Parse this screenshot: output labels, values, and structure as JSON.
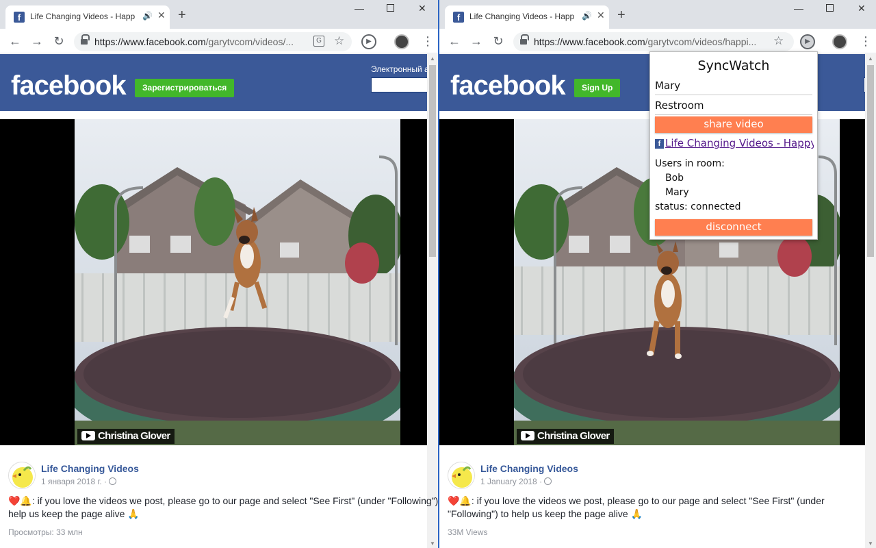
{
  "left_window": {
    "tab_title": "Life Changing Videos - Happ",
    "url_domain": "https://www.facebook.com",
    "url_path": "/garytvcom/videos/...",
    "fb_logo": "facebook",
    "signup_label": "Зарегистрироваться",
    "email_label": "Электронный а",
    "post": {
      "page_name": "Life Changing Videos",
      "date": "1 января 2018 г. ·",
      "text": "❤️🔔: if you love the videos we post, please go to our page and select \"See First\" (under \"Following\") to help us keep the page alive 🙏",
      "views": "Просмотры: 33 млн"
    },
    "video_credit": "Christina Glover"
  },
  "right_window": {
    "tab_title": "Life Changing Videos - Happ",
    "url_domain": "https://www.facebook.com",
    "url_path": "/garytvcom/videos/happi...",
    "fb_logo": "facebook",
    "signup_label": "Sign Up",
    "post": {
      "page_name": "Life Changing Videos",
      "date": "1 January 2018 ·",
      "text": "❤️🔔: if you love the videos we post, please go to our page and select \"See First\" (under \"Following\") to help us keep the page alive 🙏",
      "views": "33M Views"
    },
    "video_credit": "Christina Glover"
  },
  "syncwatch": {
    "title": "SyncWatch",
    "username": "Mary",
    "room": "Restroom",
    "share_label": "share video",
    "video_link": "Life Changing Videos - Happy...",
    "users_label": "Users in room:",
    "users": [
      "Bob",
      "Mary"
    ],
    "status": "status: connected",
    "disconnect_label": "disconnect"
  },
  "colors": {
    "facebook_blue": "#3b5998",
    "signup_green": "#42b72a",
    "syncwatch_button": "#ff7f50",
    "tabstrip": "#dee1e6",
    "window_divider": "#2b64c4"
  }
}
